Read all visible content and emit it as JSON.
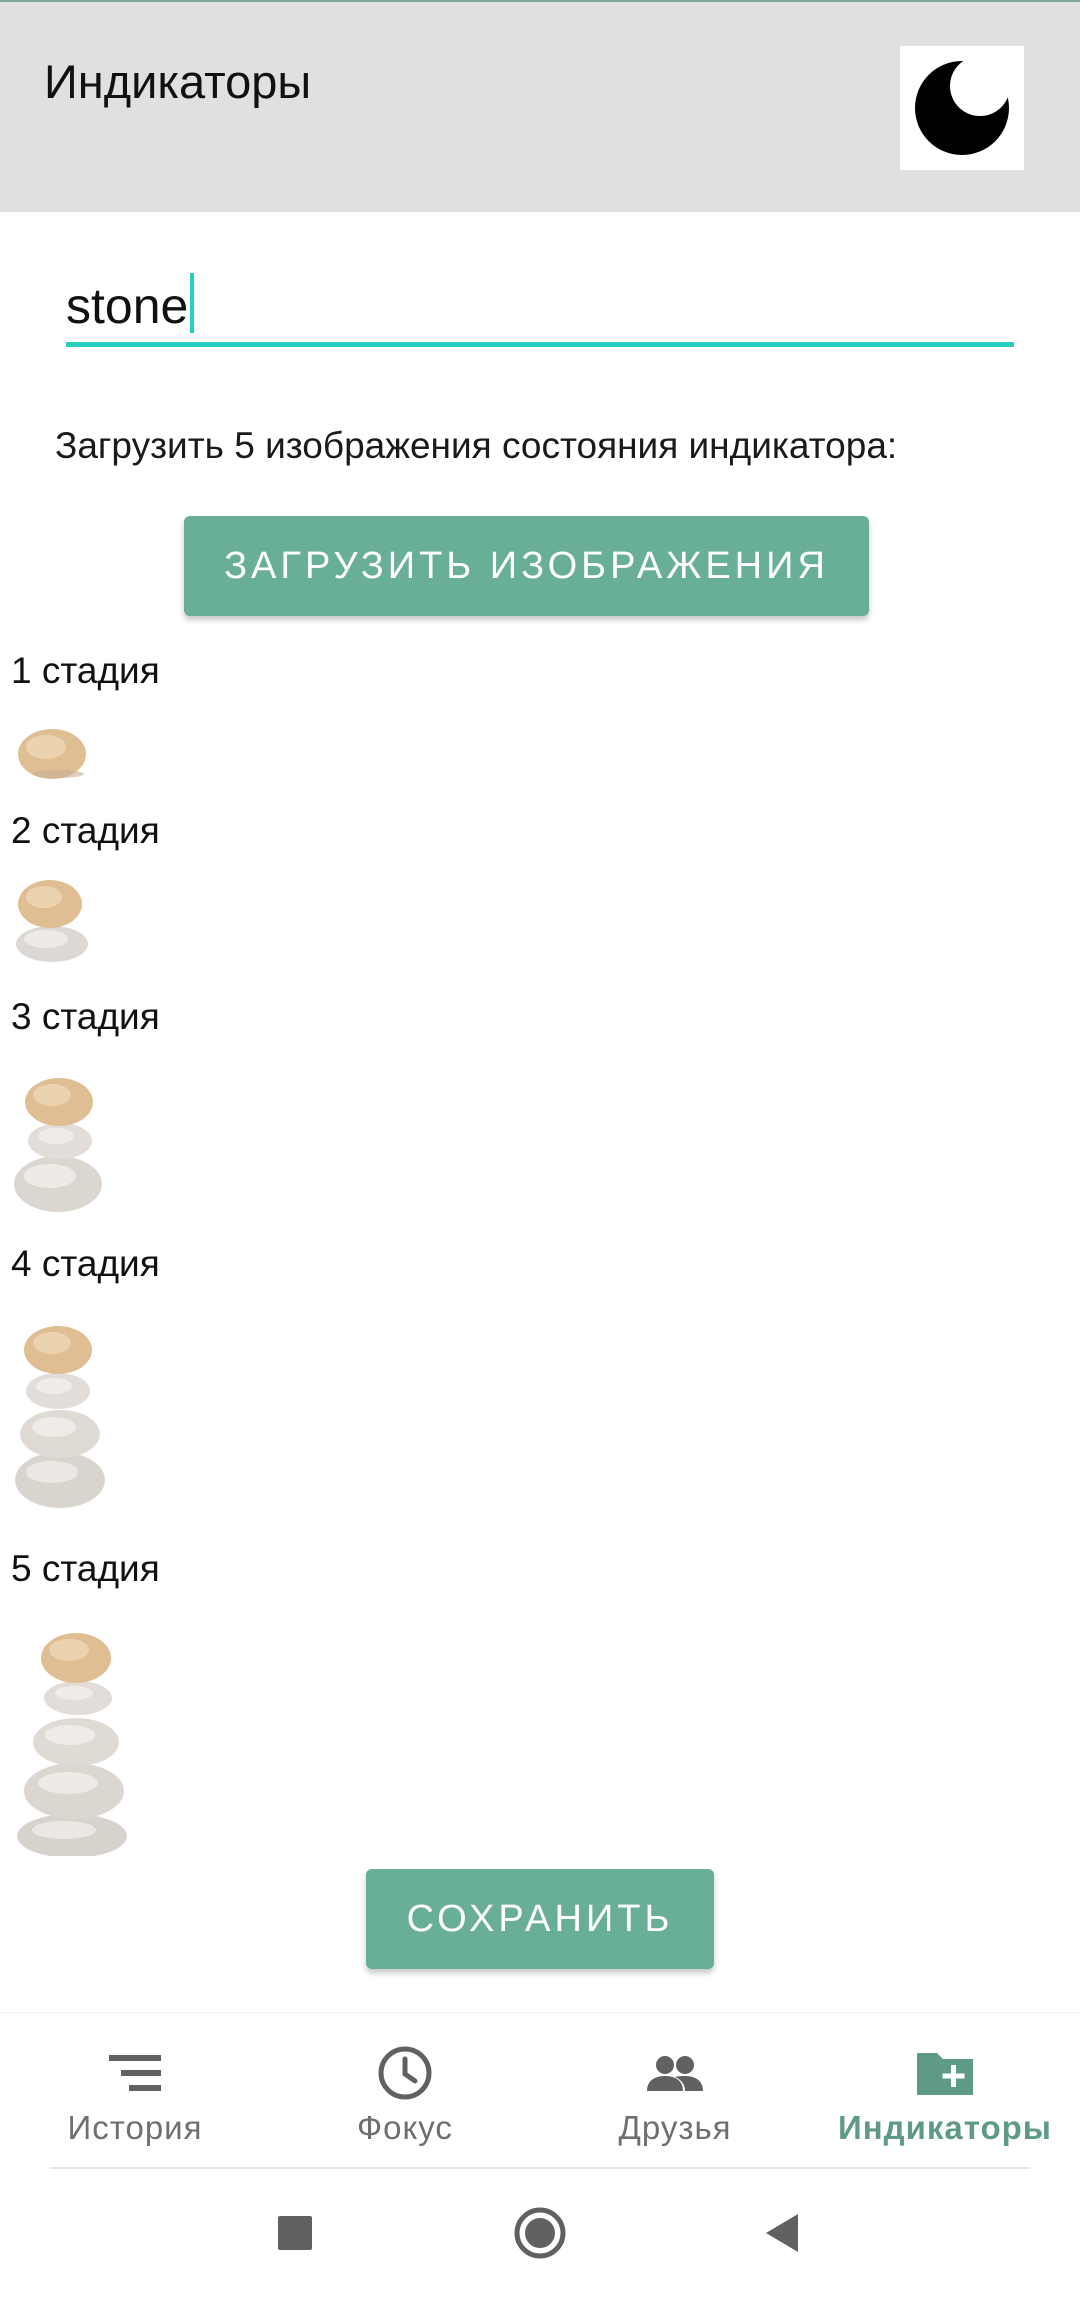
{
  "app_bar": {
    "title": "Индикаторы",
    "theme_icon": "moon-icon"
  },
  "name_field": {
    "value": "stone"
  },
  "upload": {
    "caption": "Загрузить 5 изображения состояния индикатора:",
    "button_label": "ЗАГРУЗИТЬ ИЗОБРАЖЕНИЯ"
  },
  "stages": [
    {
      "label": "1 стадия",
      "stones": 1
    },
    {
      "label": "2 стадия",
      "stones": 2
    },
    {
      "label": "3 стадия",
      "stones": 3
    },
    {
      "label": "4 стадия",
      "stones": 4
    },
    {
      "label": "5 стадия",
      "stones": 5
    }
  ],
  "save_button_label": "СОХРАНИТЬ",
  "bottom_nav": {
    "items": [
      {
        "label": "История",
        "icon": "list-icon",
        "active": false
      },
      {
        "label": "Фокус",
        "icon": "clock-icon",
        "active": false
      },
      {
        "label": "Друзья",
        "icon": "people-icon",
        "active": false
      },
      {
        "label": "Индикаторы",
        "icon": "folder-plus-icon",
        "active": true
      }
    ]
  },
  "system_nav": {
    "icons": [
      "recents-square-icon",
      "home-circle-icon",
      "back-triangle-icon"
    ]
  },
  "colors": {
    "accent": "#68ae98",
    "input_underline": "#26cfc0",
    "app_bar_bg": "#e0e0e0",
    "nav_active": "#5f9a88",
    "nav_inactive": "#6f6f6f"
  }
}
